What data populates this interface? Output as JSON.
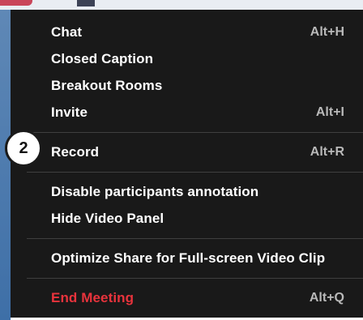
{
  "menu": {
    "items": [
      {
        "label": "Chat",
        "shortcut": "Alt+H"
      },
      {
        "label": "Closed Caption",
        "shortcut": ""
      },
      {
        "label": "Breakout Rooms",
        "shortcut": ""
      },
      {
        "label": "Invite",
        "shortcut": "Alt+I"
      },
      {
        "label": "Record",
        "shortcut": "Alt+R"
      },
      {
        "label": "Disable participants annotation",
        "shortcut": ""
      },
      {
        "label": "Hide Video Panel",
        "shortcut": ""
      },
      {
        "label": "Optimize Share for Full-screen Video Clip",
        "shortcut": ""
      },
      {
        "label": "End Meeting",
        "shortcut": "Alt+Q"
      }
    ]
  },
  "annotation": {
    "step_number": "2"
  },
  "colors": {
    "menu_background": "#191919",
    "danger_text": "#e8333c",
    "shortcut_text": "#b9b9b9"
  }
}
